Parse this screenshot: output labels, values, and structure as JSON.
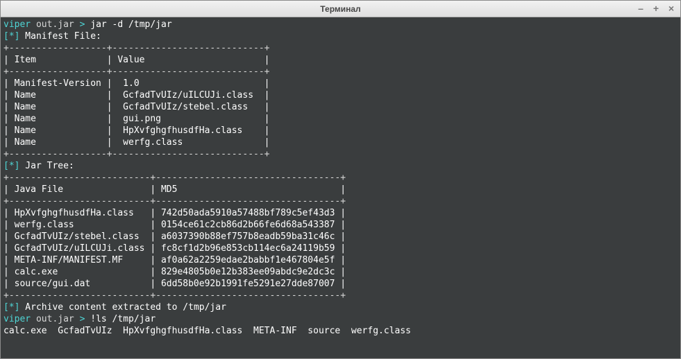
{
  "window": {
    "title": "Терминал",
    "minimize": "–",
    "maximize": "+",
    "close": "×"
  },
  "prompt1": {
    "user": "viper",
    "context": " out.jar ",
    "sep": ">",
    "cmd": " jar -d /tmp/jar"
  },
  "section1_prefix": "[*]",
  "section1_label": " Manifest File:",
  "table1": {
    "border_top": "+------------------+----------------------------+",
    "header": "| Item             | Value                      |",
    "border_mid": "+------------------+----------------------------+",
    "rows": [
      "| Manifest-Version |  1.0                       |",
      "| Name             |  GcfadTvUIz/uILCUJi.class  |",
      "| Name             |  GcfadTvUIz/stebel.class   |",
      "| Name             |  gui.png                   |",
      "| Name             |  HpXvfghgfhusdfHa.class    |",
      "| Name             |  werfg.class               |"
    ],
    "border_bot": "+------------------+----------------------------+"
  },
  "section2_prefix": "[*]",
  "section2_label": " Jar Tree:",
  "table2": {
    "border_top": "+--------------------------+----------------------------------+",
    "header": "| Java File                | MD5                              |",
    "border_mid": "+--------------------------+----------------------------------+",
    "rows": [
      "| HpXvfghgfhusdfHa.class   | 742d50ada5910a57488bf789c5ef43d3 |",
      "| werfg.class              | 0154ce61c2cb86d2b66fe6d68a543387 |",
      "| GcfadTvUIz/stebel.class  | a6037390b88ef757b8eadb59ba31c46c |",
      "| GcfadTvUIz/uILCUJi.class | fc8cf1d2b96e853cb114ec6a24119b59 |",
      "| META-INF/MANIFEST.MF     | af0a62a2259edae2babbf1e467804e5f |",
      "| calc.exe                 | 829e4805b0e12b383ee09abdc9e2dc3c |",
      "| source/gui.dat           | 6dd58b0e92b1991fe5291e27dde87007 |"
    ],
    "border_bot": "+--------------------------+----------------------------------+"
  },
  "section3_prefix": "[*]",
  "section3_label": " Archive content extracted to /tmp/jar",
  "prompt2": {
    "user": "viper",
    "context": " out.jar ",
    "sep": ">",
    "cmd": " !ls /tmp/jar"
  },
  "ls_output": "calc.exe  GcfadTvUIz  HpXvfghgfhusdfHa.class  META-INF  source  werfg.class"
}
